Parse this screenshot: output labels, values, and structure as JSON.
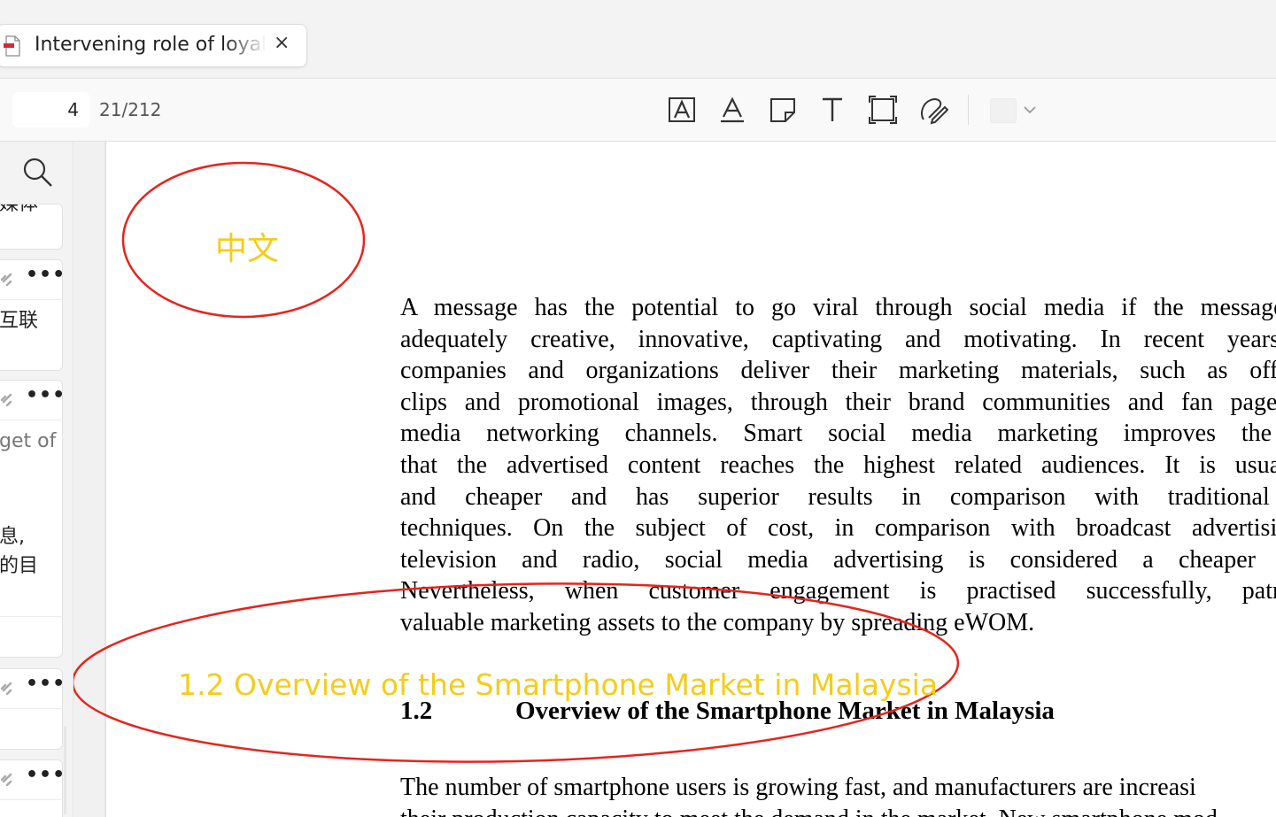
{
  "tab": {
    "title": "Intervening role of loyalty",
    "close_label": "×",
    "icon": "pdf-file-icon"
  },
  "toolbar": {
    "page_input": "4",
    "page_count": "21/212",
    "tools": [
      "text-box-tool-icon",
      "text-highlight-tool-icon",
      "sticky-note-tool-icon",
      "add-text-tool-icon",
      "area-select-tool-icon",
      "signature-tool-icon"
    ],
    "color_swatch": "#f1f1f1"
  },
  "sidebar": {
    "cards": [
      {
        "lines": [
          "媒体"
        ]
      },
      {
        "lines": [
          "互联"
        ]
      },
      {
        "lines": [
          "get of",
          "息,",
          "的目"
        ]
      },
      {
        "lines": []
      },
      {
        "lines": []
      }
    ],
    "more_label": "•••"
  },
  "document": {
    "paragraph1": [
      "A message has the potential to go viral through social media if the message content",
      "adequately creative, innovative, captivating and motivating. In recent years, differe",
      "companies and organizations deliver their marketing materials, such as official vid",
      "clips and promotional images, through their brand communities and fan pages in soc",
      "media networking channels. Smart social media marketing improves the possibil",
      "that the advertised content reaches the highest related audiences. It is usually smar",
      "and cheaper and has superior results in comparison with traditional marketi",
      "techniques. On the subject of cost, in comparison with broadcast advertising, such",
      "television and radio, social media advertising is considered a cheaper alternativ",
      "Nevertheless, when customer engagement is practised successfully, patrons act",
      "valuable marketing assets to the company by spreading eWOM."
    ],
    "heading_number": "1.2",
    "heading_title": "Overview of the Smartphone Market in Malaysia",
    "paragraph2": [
      "The number of smartphone users is growing fast, and manufacturers are increasi",
      "their production capacity to meet the demand in the market. New smartphone mod"
    ]
  },
  "annotations": {
    "top_note": "中文",
    "heading_note": "1.2  Overview of the Smartphone Market in Malaysia",
    "ellipse_color": "#e8231c",
    "text_color": "#f5cc1a"
  }
}
